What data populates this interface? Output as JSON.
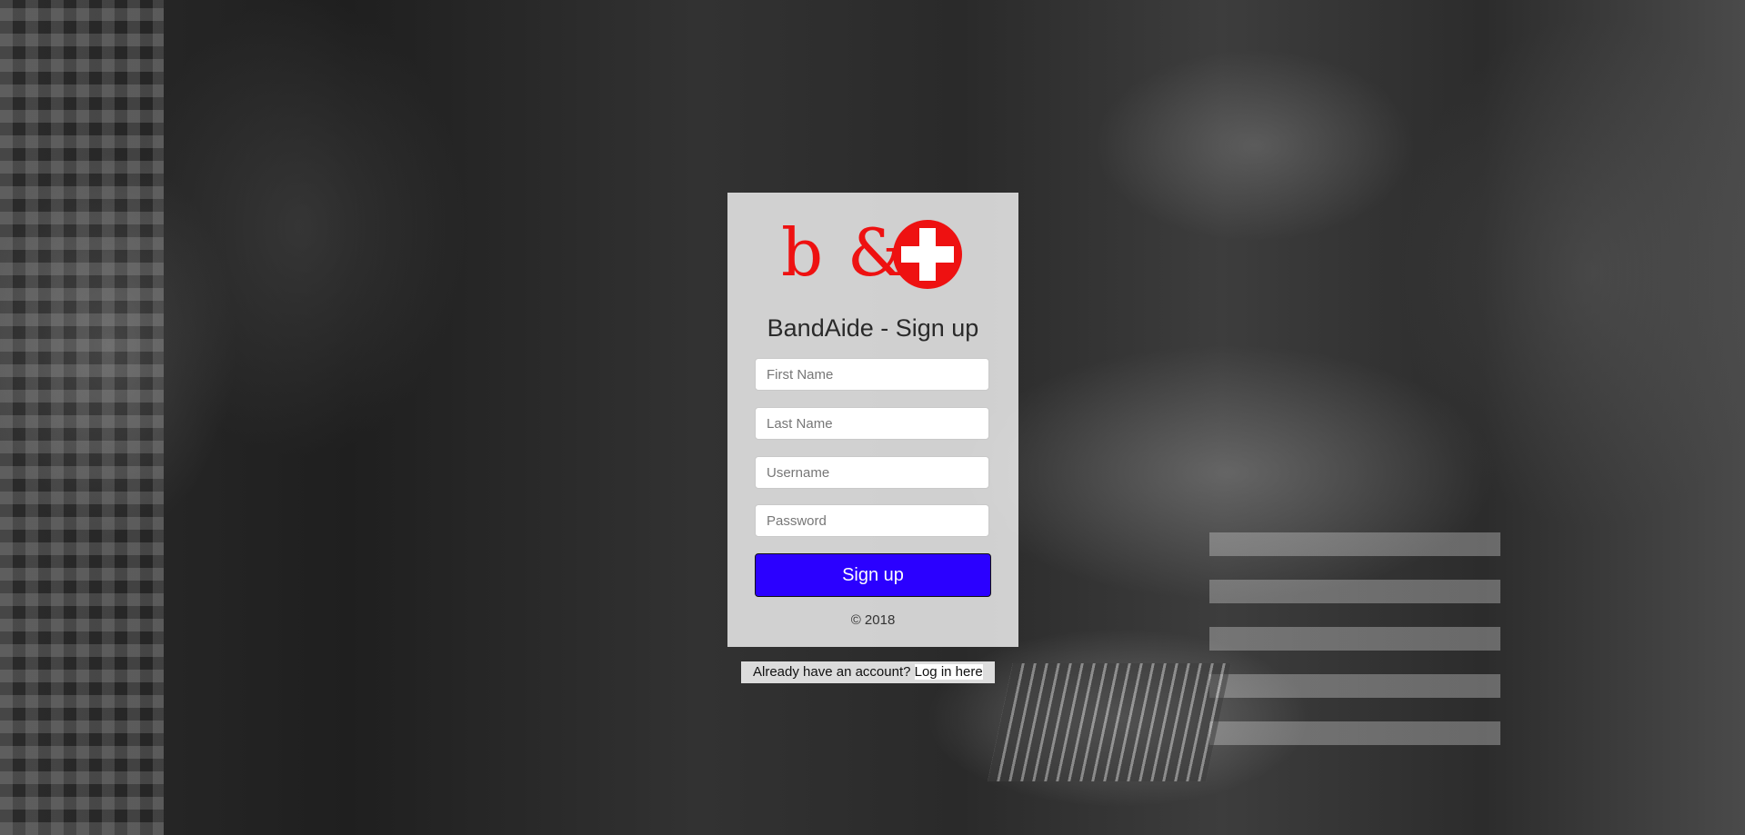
{
  "logo": {
    "text": "b &",
    "color": "#ee1111",
    "icon": "red-cross-icon"
  },
  "form": {
    "title": "BandAide - Sign up",
    "first_name_placeholder": "First Name",
    "last_name_placeholder": "Last Name",
    "username_placeholder": "Username",
    "password_placeholder": "Password",
    "submit_label": "Sign up",
    "submit_color": "#2b00ff",
    "copyright": "© 2018"
  },
  "footer": {
    "prompt": "Already have an account?",
    "login_link": "Log in here"
  }
}
